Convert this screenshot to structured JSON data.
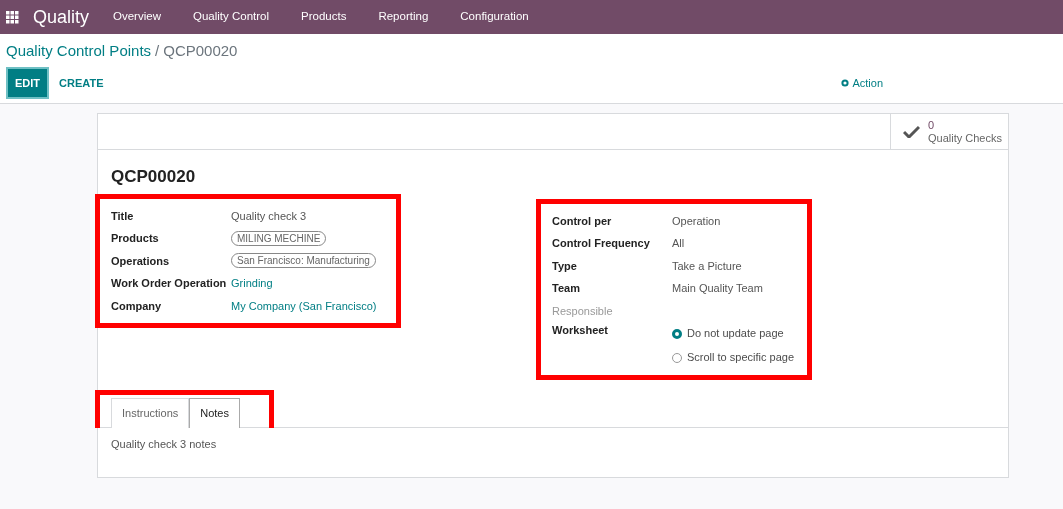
{
  "navbar": {
    "app_name": "Quality",
    "menu": [
      "Overview",
      "Quality Control",
      "Products",
      "Reporting",
      "Configuration"
    ]
  },
  "breadcrumb": {
    "parent": "Quality Control Points",
    "separator": "/",
    "current": "QCP00020"
  },
  "buttons": [
    {
      "label": "EDIT",
      "kind": "primary"
    },
    {
      "label": "CREATE",
      "kind": "link"
    }
  ],
  "action": {
    "label": "Action"
  },
  "stat_button": {
    "count": "0",
    "label": "Quality Checks"
  },
  "record": {
    "name": "QCP00020",
    "left_group": {
      "highlighted": true,
      "fields": [
        {
          "label": "Title",
          "value": "Quality check 3",
          "kind": "text"
        },
        {
          "label": "Products",
          "value": "MILING MECHINE",
          "kind": "tag"
        },
        {
          "label": "Operations",
          "value": "San Francisco: Manufacturing",
          "kind": "tag"
        },
        {
          "label": "Work Order Operation",
          "value": "Grinding",
          "kind": "link"
        },
        {
          "label": "Company",
          "value": "My Company (San Francisco)",
          "kind": "link"
        }
      ]
    },
    "right_group": {
      "highlighted": true,
      "fields": [
        {
          "label": "Control per",
          "value": "Operation",
          "kind": "text"
        },
        {
          "label": "Control Frequency",
          "value": "All",
          "kind": "text"
        },
        {
          "label": "Type",
          "value": "Take a Picture",
          "kind": "text"
        },
        {
          "label": "Team",
          "value": "Main Quality Team",
          "kind": "text"
        },
        {
          "label": "Responsible",
          "kind": "empty"
        },
        {
          "label": "Worksheet",
          "kind": "radio",
          "options": [
            {
              "label": "Do not update page",
              "selected": true
            },
            {
              "label": "Scroll to specific page",
              "selected": false
            }
          ]
        }
      ]
    }
  },
  "notebook": {
    "highlighted": true,
    "tabs": [
      {
        "label": "Instructions",
        "selected": false
      },
      {
        "label": "Notes",
        "selected": true
      }
    ],
    "content": "Quality check 3 notes"
  }
}
